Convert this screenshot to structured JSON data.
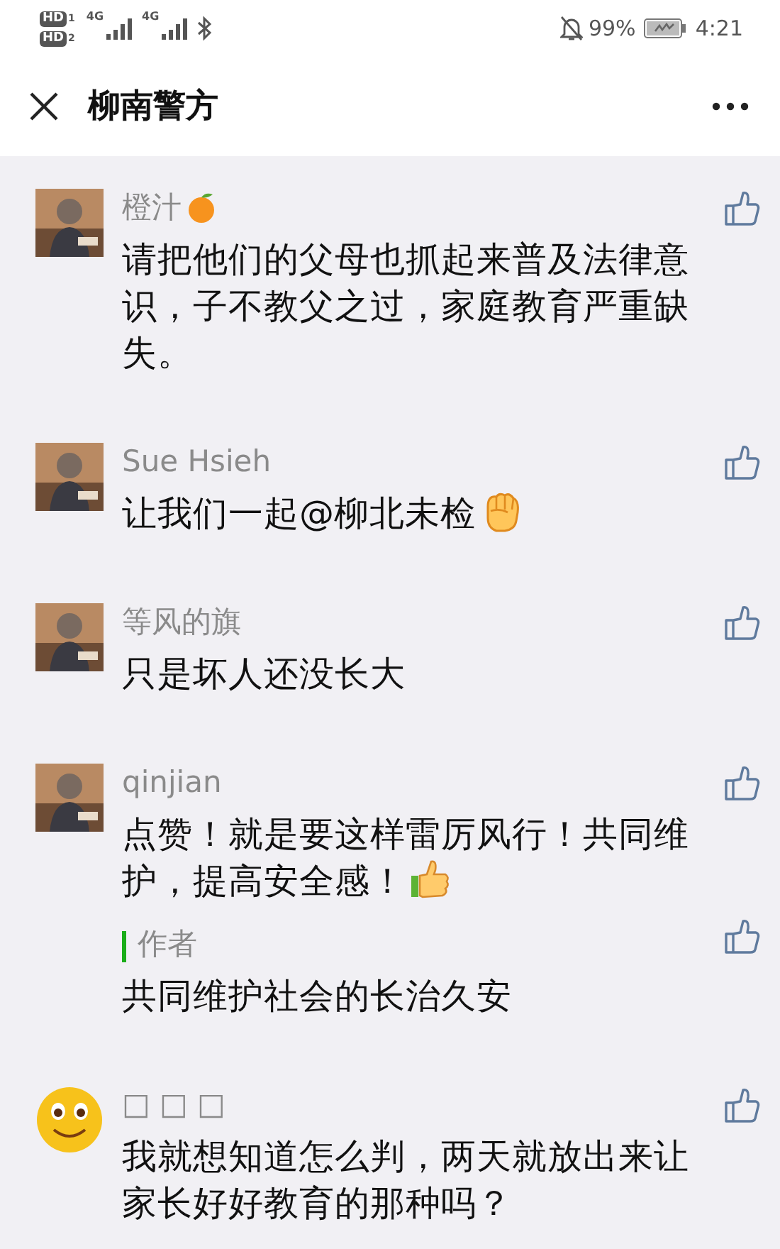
{
  "status_bar": {
    "hd": [
      {
        "text": "HD",
        "sim": "1"
      },
      {
        "text": "HD",
        "sim": "2"
      }
    ],
    "networks": [
      "4G",
      "4G"
    ],
    "battery_text": "99%",
    "time": "4:21"
  },
  "header": {
    "title": "柳南警方"
  },
  "comments": [
    {
      "name": "橙汁",
      "name_emoji": {
        "kind": "fruit"
      },
      "text": "请把他们的父母也抓起来普及法律意识，子不教父之过，家庭教育严重缺失。"
    },
    {
      "name": "Sue Hsieh",
      "text": "让我们一起@柳北未检",
      "text_emoji": {
        "kind": "fist"
      }
    },
    {
      "name": "等风的旗",
      "text": "只是坏人还没长大"
    },
    {
      "name": "qinjian",
      "text": "点赞！就是要这样雷厉风行！共同维护，提高安全感！",
      "text_emoji": {
        "kind": "thumb"
      },
      "reply": {
        "label": "作者",
        "text": "共同维护社会的长治久安"
      }
    },
    {
      "name": "□ □ □",
      "avatar": {
        "kind": "smiley"
      },
      "text": "我就想知道怎么判，两天就放出来让家长好好教育的那种吗？"
    }
  ]
}
